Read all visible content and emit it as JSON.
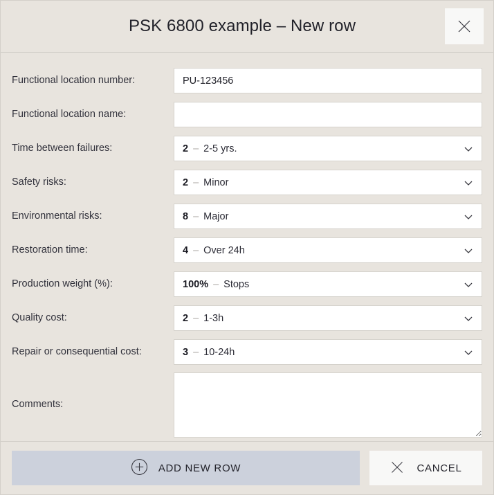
{
  "header": {
    "title": "PSK 6800 example – New row",
    "close_icon": "close-icon"
  },
  "form": {
    "fields": [
      {
        "kind": "text",
        "name": "functional-location-number",
        "label": "Functional location number:",
        "value": "PU-123456",
        "placeholder": ""
      },
      {
        "kind": "text",
        "name": "functional-location-name",
        "label": "Functional location name:",
        "value": "",
        "placeholder": ""
      },
      {
        "kind": "select",
        "name": "time-between-failures",
        "label": "Time between failures:",
        "code": "2",
        "dash": "–",
        "text": "2-5 yrs.",
        "chevron_icon": "chevron-down-icon"
      },
      {
        "kind": "select",
        "name": "safety-risks",
        "label": "Safety risks:",
        "code": "2",
        "dash": "–",
        "text": "Minor",
        "chevron_icon": "chevron-down-icon"
      },
      {
        "kind": "select",
        "name": "environmental-risks",
        "label": "Environmental risks:",
        "code": "8",
        "dash": "–",
        "text": "Major",
        "chevron_icon": "chevron-down-icon"
      },
      {
        "kind": "select",
        "name": "restoration-time",
        "label": "Restoration time:",
        "code": "4",
        "dash": "–",
        "text": "Over 24h",
        "chevron_icon": "chevron-down-icon"
      },
      {
        "kind": "select",
        "name": "production-weight",
        "label": "Production weight (%):",
        "code": "100%",
        "dash": "–",
        "text": "Stops",
        "chevron_icon": "chevron-down-icon"
      },
      {
        "kind": "select",
        "name": "quality-cost",
        "label": "Quality cost:",
        "code": "2",
        "dash": "–",
        "text": "1-3h",
        "chevron_icon": "chevron-down-icon"
      },
      {
        "kind": "select",
        "name": "repair-or-consequential-cost",
        "label": "Repair or consequential cost:",
        "code": "3",
        "dash": "–",
        "text": "10-24h",
        "chevron_icon": "chevron-down-icon"
      },
      {
        "kind": "textarea",
        "name": "comments",
        "label": "Comments:",
        "value": "",
        "placeholder": ""
      }
    ]
  },
  "footer": {
    "add_label": "ADD NEW ROW",
    "add_icon": "plus-circle-icon",
    "cancel_label": "CANCEL",
    "cancel_icon": "close-icon"
  },
  "colors": {
    "background": "#e8e4de",
    "field_background": "#ffffff",
    "field_border": "#d5d2cc",
    "primary_button": "#ccd1dc",
    "secondary_button": "#f8f8f7",
    "text": "#22222a",
    "muted_text": "#a9a6a0"
  }
}
